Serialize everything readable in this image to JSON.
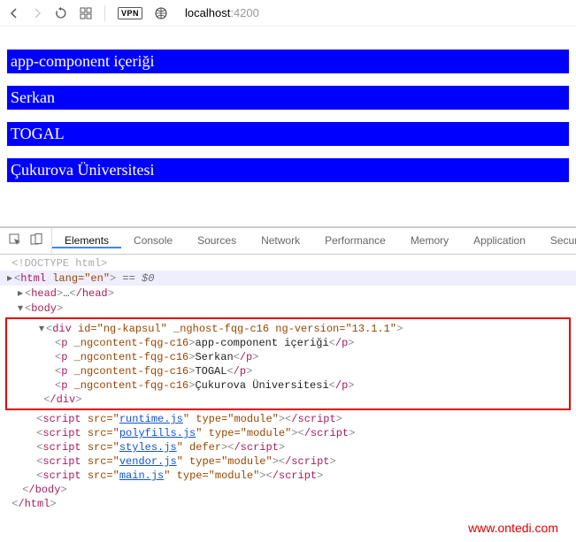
{
  "toolbar": {
    "vpn_label": "VPN",
    "url_host": "localhost",
    "url_port": ":4200"
  },
  "page": {
    "bars": [
      "app-component içeriği",
      "Serkan",
      "TOGAL",
      "Çukurova Üniversitesi"
    ]
  },
  "devtools": {
    "tabs": [
      "Elements",
      "Console",
      "Sources",
      "Network",
      "Performance",
      "Memory",
      "Application",
      "Security"
    ],
    "active_tab": 0,
    "doctype": "<!DOCTYPE html>",
    "html_open": "html",
    "html_lang_attr": "lang=\"en\"",
    "eq0": " == $0",
    "head_open": "head",
    "head_ellipsis": "…",
    "head_close": "/head",
    "body_open": "body",
    "div_open": "div",
    "div_attrs": " id=\"ng-kapsul\" _nghost-fqg-c16 ng-version=\"13.1.1\"",
    "p_tag": "p",
    "p_attr": " _ngcontent-fqg-c16",
    "p_texts": [
      "app-component içeriği",
      "Serkan",
      "TOGAL",
      "Çukurova Üniversitesi"
    ],
    "div_close": "/div",
    "scripts": [
      {
        "src": "runtime.js",
        "extra": " type=\"module\""
      },
      {
        "src": "polyfills.js",
        "extra": " type=\"module\""
      },
      {
        "src": "styles.js",
        "extra": " defer"
      },
      {
        "src": "vendor.js",
        "extra": " type=\"module\""
      },
      {
        "src": "main.js",
        "extra": " type=\"module\""
      }
    ],
    "script_tag": "script",
    "src_attr_prefix": " src=\"",
    "src_attr_suffix": "\"",
    "script_close": "/script",
    "body_close": "/body",
    "html_close": "/html"
  },
  "watermark": "www.ontedi.com"
}
